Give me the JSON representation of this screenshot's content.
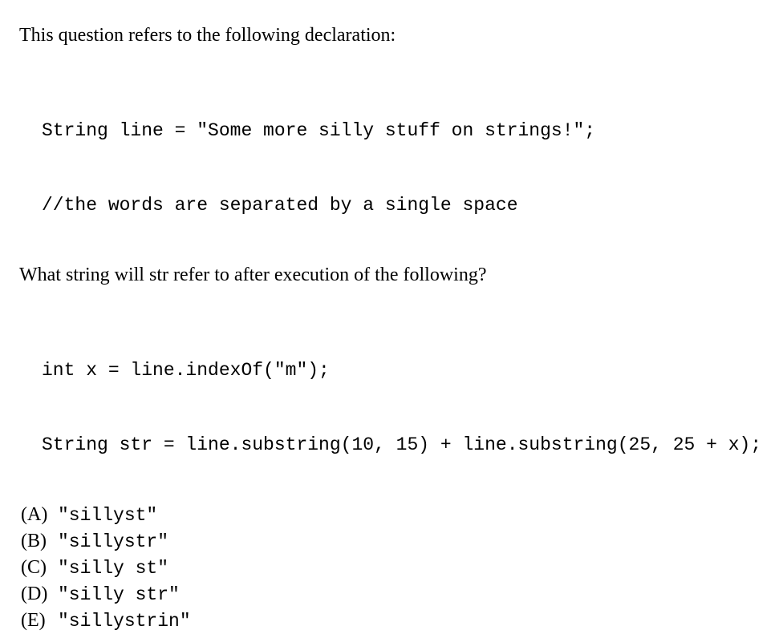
{
  "intro": "This question refers to the following declaration:",
  "code1_line1": "String line = \"Some more silly stuff on strings!\";",
  "code1_line2": "//the words are separated by a single space",
  "question": "What string will str refer to after execution of the following?",
  "code2_line1": "int x = line.indexOf(\"m\");",
  "code2_line2": "String str = line.substring(10, 15) + line.substring(25, 25 + x);",
  "options": [
    {
      "label": "(A)",
      "value": "\"sillyst\""
    },
    {
      "label": "(B)",
      "value": "\"sillystr\""
    },
    {
      "label": "(C)",
      "value": "\"silly st\""
    },
    {
      "label": "(D)",
      "value": "\"silly str\""
    },
    {
      "label": "(E)",
      "value": "\"sillystrin\""
    }
  ]
}
